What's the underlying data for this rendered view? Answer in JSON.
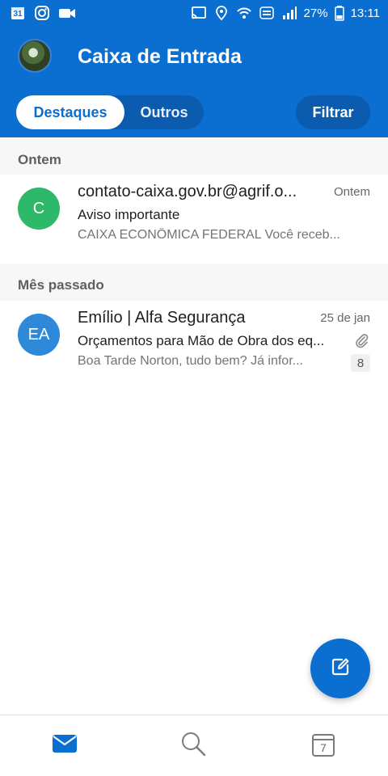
{
  "status_bar": {
    "battery": "27%",
    "time": "13:11",
    "calendar_day": "31",
    "icons": [
      "calendar-icon",
      "instagram-icon",
      "video-camera-icon",
      "cast-icon",
      "location-icon",
      "wifi-icon",
      "volte-icon",
      "signal-icon",
      "battery-icon"
    ]
  },
  "header": {
    "title": "Caixa de Entrada",
    "tabs": [
      {
        "label": "Destaques",
        "selected": true
      },
      {
        "label": "Outros",
        "selected": false
      }
    ],
    "filter_label": "Filtrar"
  },
  "sections": [
    {
      "label": "Ontem",
      "emails": [
        {
          "initials": "C",
          "avatar_color": "#2eb86a",
          "sender": "contato-caixa.gov.br@agrif.o...",
          "date": "Ontem",
          "subject": "Aviso importante",
          "preview": "CAIXA ECONÔMICA FEDERAL Você receb..."
        }
      ]
    },
    {
      "label": "Mês passado",
      "emails": [
        {
          "initials": "EA",
          "avatar_color": "#2e8ad8",
          "sender": "Emílio | Alfa Segurança",
          "date": "25 de jan",
          "subject": "Orçamentos para Mão de Obra dos eq...",
          "preview": "Boa Tarde Norton, tudo bem? Já infor...",
          "has_attachment": true,
          "thread_count": "8"
        }
      ]
    }
  ],
  "bottom_nav": {
    "calendar_day": "7",
    "items": [
      "mail-icon",
      "search-icon",
      "calendar-icon"
    ]
  },
  "colors": {
    "brand": "#0a6fd0",
    "segment_bg": "#0b5cae"
  }
}
